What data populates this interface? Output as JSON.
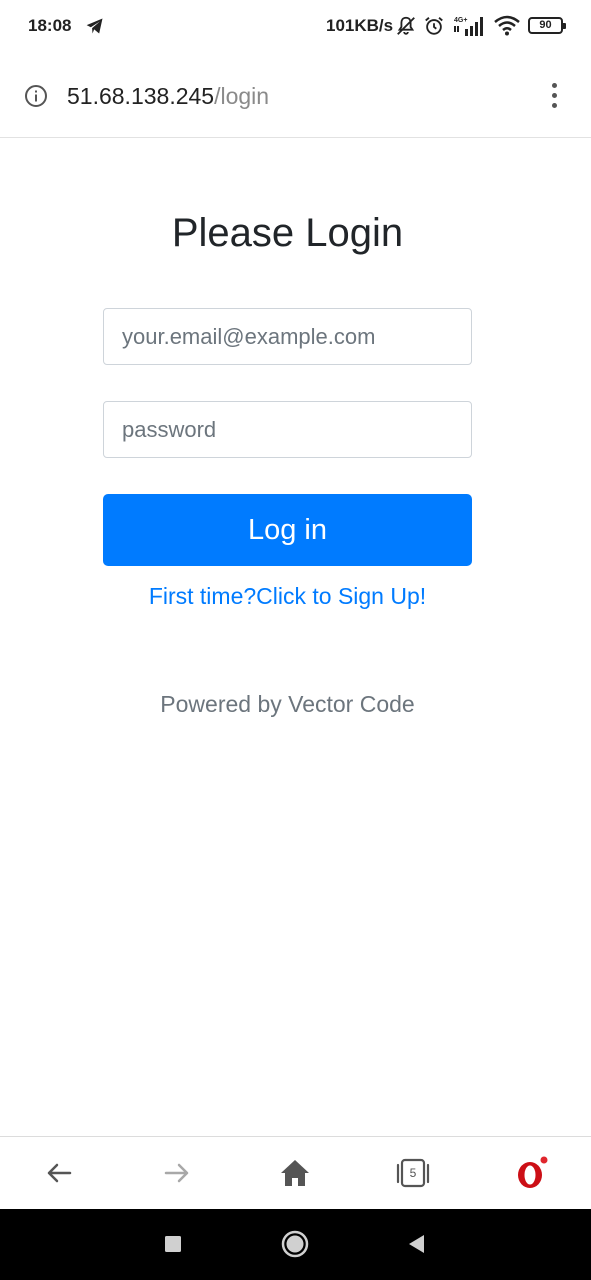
{
  "status_bar": {
    "time": "18:08",
    "net_speed": "101KB/s",
    "battery": "90",
    "network_label": "4G+",
    "icons": [
      "telegram-icon",
      "mute-icon",
      "alarm-icon",
      "signal-icon",
      "wifi-icon",
      "battery-icon"
    ]
  },
  "address_bar": {
    "host": "51.68.138.245",
    "path": "/login",
    "icons": [
      "info-icon",
      "menu-icon"
    ]
  },
  "login": {
    "title": "Please Login",
    "email_placeholder": "your.email@example.com",
    "password_placeholder": "password",
    "login_label": "Log in",
    "signup_link": "First time?Click to Sign Up!",
    "footer": "Powered by Vector Code"
  },
  "toolbar": {
    "tabs_count": "5",
    "icons": [
      "back-arrow-icon",
      "forward-arrow-icon",
      "home-icon",
      "tabs-icon",
      "opera-icon"
    ]
  },
  "colors": {
    "primary": "#007bff",
    "text": "#212529",
    "muted": "#6c757d",
    "opera_red": "#cc0f16"
  }
}
